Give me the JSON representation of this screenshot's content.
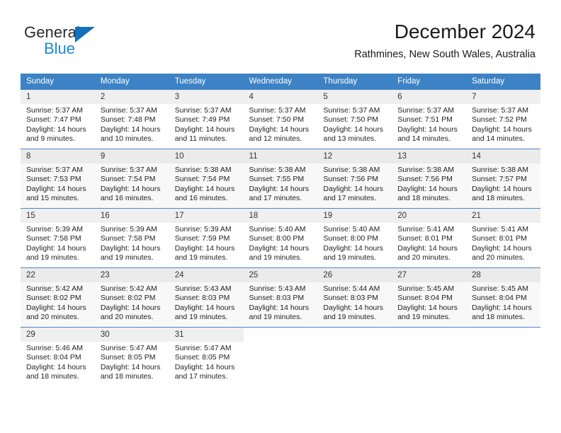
{
  "brand": {
    "name_part1": "General",
    "name_part2": "Blue",
    "logo_icon": "triangle-logo-icon",
    "accent_color": "#1271bd",
    "secondary_color": "#1f86d4"
  },
  "header": {
    "title": "December 2024",
    "subtitle": "Rathmines, New South Wales, Australia"
  },
  "calendar": {
    "header_background": "#3d82c4",
    "header_text_color": "#ffffff",
    "weekday_headers": [
      "Sunday",
      "Monday",
      "Tuesday",
      "Wednesday",
      "Thursday",
      "Friday",
      "Saturday"
    ],
    "weeks": [
      [
        {
          "day": "1",
          "sunrise": "Sunrise: 5:37 AM",
          "sunset": "Sunset: 7:47 PM",
          "daylight_line1": "Daylight: 14 hours",
          "daylight_line2": "and 9 minutes."
        },
        {
          "day": "2",
          "sunrise": "Sunrise: 5:37 AM",
          "sunset": "Sunset: 7:48 PM",
          "daylight_line1": "Daylight: 14 hours",
          "daylight_line2": "and 10 minutes."
        },
        {
          "day": "3",
          "sunrise": "Sunrise: 5:37 AM",
          "sunset": "Sunset: 7:49 PM",
          "daylight_line1": "Daylight: 14 hours",
          "daylight_line2": "and 11 minutes."
        },
        {
          "day": "4",
          "sunrise": "Sunrise: 5:37 AM",
          "sunset": "Sunset: 7:50 PM",
          "daylight_line1": "Daylight: 14 hours",
          "daylight_line2": "and 12 minutes."
        },
        {
          "day": "5",
          "sunrise": "Sunrise: 5:37 AM",
          "sunset": "Sunset: 7:50 PM",
          "daylight_line1": "Daylight: 14 hours",
          "daylight_line2": "and 13 minutes."
        },
        {
          "day": "6",
          "sunrise": "Sunrise: 5:37 AM",
          "sunset": "Sunset: 7:51 PM",
          "daylight_line1": "Daylight: 14 hours",
          "daylight_line2": "and 14 minutes."
        },
        {
          "day": "7",
          "sunrise": "Sunrise: 5:37 AM",
          "sunset": "Sunset: 7:52 PM",
          "daylight_line1": "Daylight: 14 hours",
          "daylight_line2": "and 14 minutes."
        }
      ],
      [
        {
          "day": "8",
          "sunrise": "Sunrise: 5:37 AM",
          "sunset": "Sunset: 7:53 PM",
          "daylight_line1": "Daylight: 14 hours",
          "daylight_line2": "and 15 minutes."
        },
        {
          "day": "9",
          "sunrise": "Sunrise: 5:37 AM",
          "sunset": "Sunset: 7:54 PM",
          "daylight_line1": "Daylight: 14 hours",
          "daylight_line2": "and 16 minutes."
        },
        {
          "day": "10",
          "sunrise": "Sunrise: 5:38 AM",
          "sunset": "Sunset: 7:54 PM",
          "daylight_line1": "Daylight: 14 hours",
          "daylight_line2": "and 16 minutes."
        },
        {
          "day": "11",
          "sunrise": "Sunrise: 5:38 AM",
          "sunset": "Sunset: 7:55 PM",
          "daylight_line1": "Daylight: 14 hours",
          "daylight_line2": "and 17 minutes."
        },
        {
          "day": "12",
          "sunrise": "Sunrise: 5:38 AM",
          "sunset": "Sunset: 7:56 PM",
          "daylight_line1": "Daylight: 14 hours",
          "daylight_line2": "and 17 minutes."
        },
        {
          "day": "13",
          "sunrise": "Sunrise: 5:38 AM",
          "sunset": "Sunset: 7:56 PM",
          "daylight_line1": "Daylight: 14 hours",
          "daylight_line2": "and 18 minutes."
        },
        {
          "day": "14",
          "sunrise": "Sunrise: 5:38 AM",
          "sunset": "Sunset: 7:57 PM",
          "daylight_line1": "Daylight: 14 hours",
          "daylight_line2": "and 18 minutes."
        }
      ],
      [
        {
          "day": "15",
          "sunrise": "Sunrise: 5:39 AM",
          "sunset": "Sunset: 7:58 PM",
          "daylight_line1": "Daylight: 14 hours",
          "daylight_line2": "and 19 minutes."
        },
        {
          "day": "16",
          "sunrise": "Sunrise: 5:39 AM",
          "sunset": "Sunset: 7:58 PM",
          "daylight_line1": "Daylight: 14 hours",
          "daylight_line2": "and 19 minutes."
        },
        {
          "day": "17",
          "sunrise": "Sunrise: 5:39 AM",
          "sunset": "Sunset: 7:59 PM",
          "daylight_line1": "Daylight: 14 hours",
          "daylight_line2": "and 19 minutes."
        },
        {
          "day": "18",
          "sunrise": "Sunrise: 5:40 AM",
          "sunset": "Sunset: 8:00 PM",
          "daylight_line1": "Daylight: 14 hours",
          "daylight_line2": "and 19 minutes."
        },
        {
          "day": "19",
          "sunrise": "Sunrise: 5:40 AM",
          "sunset": "Sunset: 8:00 PM",
          "daylight_line1": "Daylight: 14 hours",
          "daylight_line2": "and 19 minutes."
        },
        {
          "day": "20",
          "sunrise": "Sunrise: 5:41 AM",
          "sunset": "Sunset: 8:01 PM",
          "daylight_line1": "Daylight: 14 hours",
          "daylight_line2": "and 20 minutes."
        },
        {
          "day": "21",
          "sunrise": "Sunrise: 5:41 AM",
          "sunset": "Sunset: 8:01 PM",
          "daylight_line1": "Daylight: 14 hours",
          "daylight_line2": "and 20 minutes."
        }
      ],
      [
        {
          "day": "22",
          "sunrise": "Sunrise: 5:42 AM",
          "sunset": "Sunset: 8:02 PM",
          "daylight_line1": "Daylight: 14 hours",
          "daylight_line2": "and 20 minutes."
        },
        {
          "day": "23",
          "sunrise": "Sunrise: 5:42 AM",
          "sunset": "Sunset: 8:02 PM",
          "daylight_line1": "Daylight: 14 hours",
          "daylight_line2": "and 20 minutes."
        },
        {
          "day": "24",
          "sunrise": "Sunrise: 5:43 AM",
          "sunset": "Sunset: 8:03 PM",
          "daylight_line1": "Daylight: 14 hours",
          "daylight_line2": "and 19 minutes."
        },
        {
          "day": "25",
          "sunrise": "Sunrise: 5:43 AM",
          "sunset": "Sunset: 8:03 PM",
          "daylight_line1": "Daylight: 14 hours",
          "daylight_line2": "and 19 minutes."
        },
        {
          "day": "26",
          "sunrise": "Sunrise: 5:44 AM",
          "sunset": "Sunset: 8:03 PM",
          "daylight_line1": "Daylight: 14 hours",
          "daylight_line2": "and 19 minutes."
        },
        {
          "day": "27",
          "sunrise": "Sunrise: 5:45 AM",
          "sunset": "Sunset: 8:04 PM",
          "daylight_line1": "Daylight: 14 hours",
          "daylight_line2": "and 19 minutes."
        },
        {
          "day": "28",
          "sunrise": "Sunrise: 5:45 AM",
          "sunset": "Sunset: 8:04 PM",
          "daylight_line1": "Daylight: 14 hours",
          "daylight_line2": "and 18 minutes."
        }
      ],
      [
        {
          "day": "29",
          "sunrise": "Sunrise: 5:46 AM",
          "sunset": "Sunset: 8:04 PM",
          "daylight_line1": "Daylight: 14 hours",
          "daylight_line2": "and 18 minutes."
        },
        {
          "day": "30",
          "sunrise": "Sunrise: 5:47 AM",
          "sunset": "Sunset: 8:05 PM",
          "daylight_line1": "Daylight: 14 hours",
          "daylight_line2": "and 18 minutes."
        },
        {
          "day": "31",
          "sunrise": "Sunrise: 5:47 AM",
          "sunset": "Sunset: 8:05 PM",
          "daylight_line1": "Daylight: 14 hours",
          "daylight_line2": "and 17 minutes."
        },
        {
          "day": "",
          "sunrise": "",
          "sunset": "",
          "daylight_line1": "",
          "daylight_line2": ""
        },
        {
          "day": "",
          "sunrise": "",
          "sunset": "",
          "daylight_line1": "",
          "daylight_line2": ""
        },
        {
          "day": "",
          "sunrise": "",
          "sunset": "",
          "daylight_line1": "",
          "daylight_line2": ""
        },
        {
          "day": "",
          "sunrise": "",
          "sunset": "",
          "daylight_line1": "",
          "daylight_line2": ""
        }
      ]
    ]
  }
}
